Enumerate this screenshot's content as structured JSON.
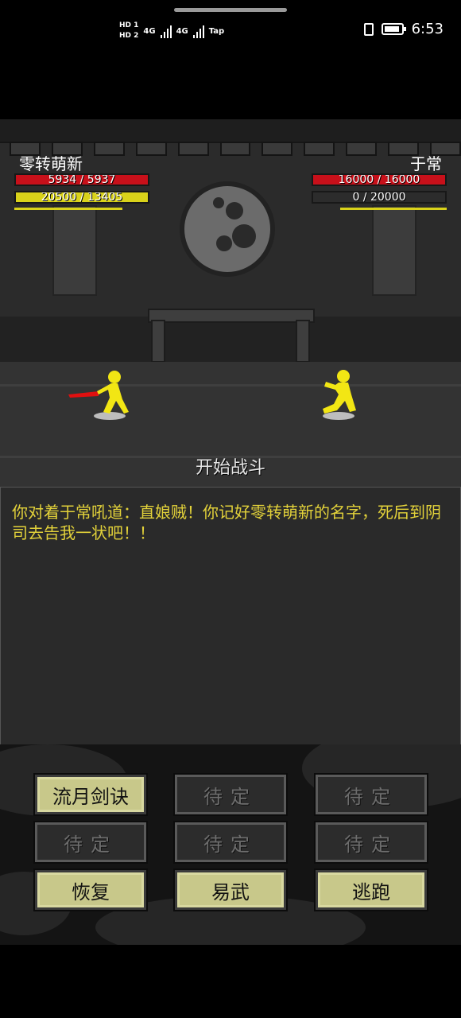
{
  "status_bar": {
    "sim1": "HD 1",
    "sim2": "HD 2",
    "net1": "4G",
    "net2": "4G",
    "tap": "Tap",
    "time": "6:53"
  },
  "player": {
    "name": "零转萌新",
    "hp_text": "5934 / 5937",
    "hp_fraction": 0.999,
    "mp_text": "20500 / 13405",
    "mp_fraction": 1.0
  },
  "enemy": {
    "name": "于常",
    "hp_text": "16000 / 16000",
    "hp_fraction": 1.0,
    "mp_text": "0 / 20000",
    "mp_fraction": 0.0
  },
  "battle_status": "开始战斗",
  "log": {
    "message": "你对着于常吼道：直娘贼！你记好零转萌新的名字，死后到阴司去告我一状吧！！"
  },
  "actions": [
    {
      "label": "流月剑诀",
      "enabled": true
    },
    {
      "label": "待定",
      "enabled": false
    },
    {
      "label": "待定",
      "enabled": false
    },
    {
      "label": "待定",
      "enabled": false
    },
    {
      "label": "待定",
      "enabled": false
    },
    {
      "label": "待定",
      "enabled": false
    },
    {
      "label": "恢复",
      "enabled": true
    },
    {
      "label": "易武",
      "enabled": true
    },
    {
      "label": "逃跑",
      "enabled": true
    }
  ],
  "colors": {
    "hp": "#c8101a",
    "mp": "#d9d21a",
    "fighter": "#f2e614",
    "blade": "#e01010",
    "log_text": "#e3d23a",
    "button_active": "#c8c88a"
  }
}
